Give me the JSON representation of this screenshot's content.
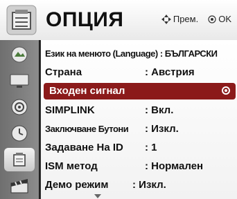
{
  "header": {
    "title": "ОПЦИЯ",
    "hint_move": "Прем.",
    "hint_ok": "OK"
  },
  "sidebar": {
    "items": [
      {
        "icon": "picture-icon"
      },
      {
        "icon": "screen-icon"
      },
      {
        "icon": "audio-icon"
      },
      {
        "icon": "clock-icon"
      },
      {
        "icon": "option-icon",
        "active": true
      },
      {
        "icon": "media-icon"
      }
    ]
  },
  "menu": {
    "rows": [
      {
        "label": "Език на менюто (Language) : БЪЛГАРСКИ",
        "value": ""
      },
      {
        "label": "Страна",
        "value": ": Австрия"
      },
      {
        "label": "Входен сигнал",
        "value": ""
      },
      {
        "label": "SIMPLINK",
        "value": ": Вкл."
      },
      {
        "label": "Заключване Бутони",
        "value": ": Изкл."
      },
      {
        "label": "Задаване На ID",
        "value": ": 1"
      },
      {
        "label": "ISM метод",
        "value": ": Нормален"
      },
      {
        "label": "Демо режим",
        "value": ": Изкл."
      }
    ]
  },
  "colors": {
    "highlight": "#8b1a1a",
    "sidebar": "#7a7a7a"
  }
}
